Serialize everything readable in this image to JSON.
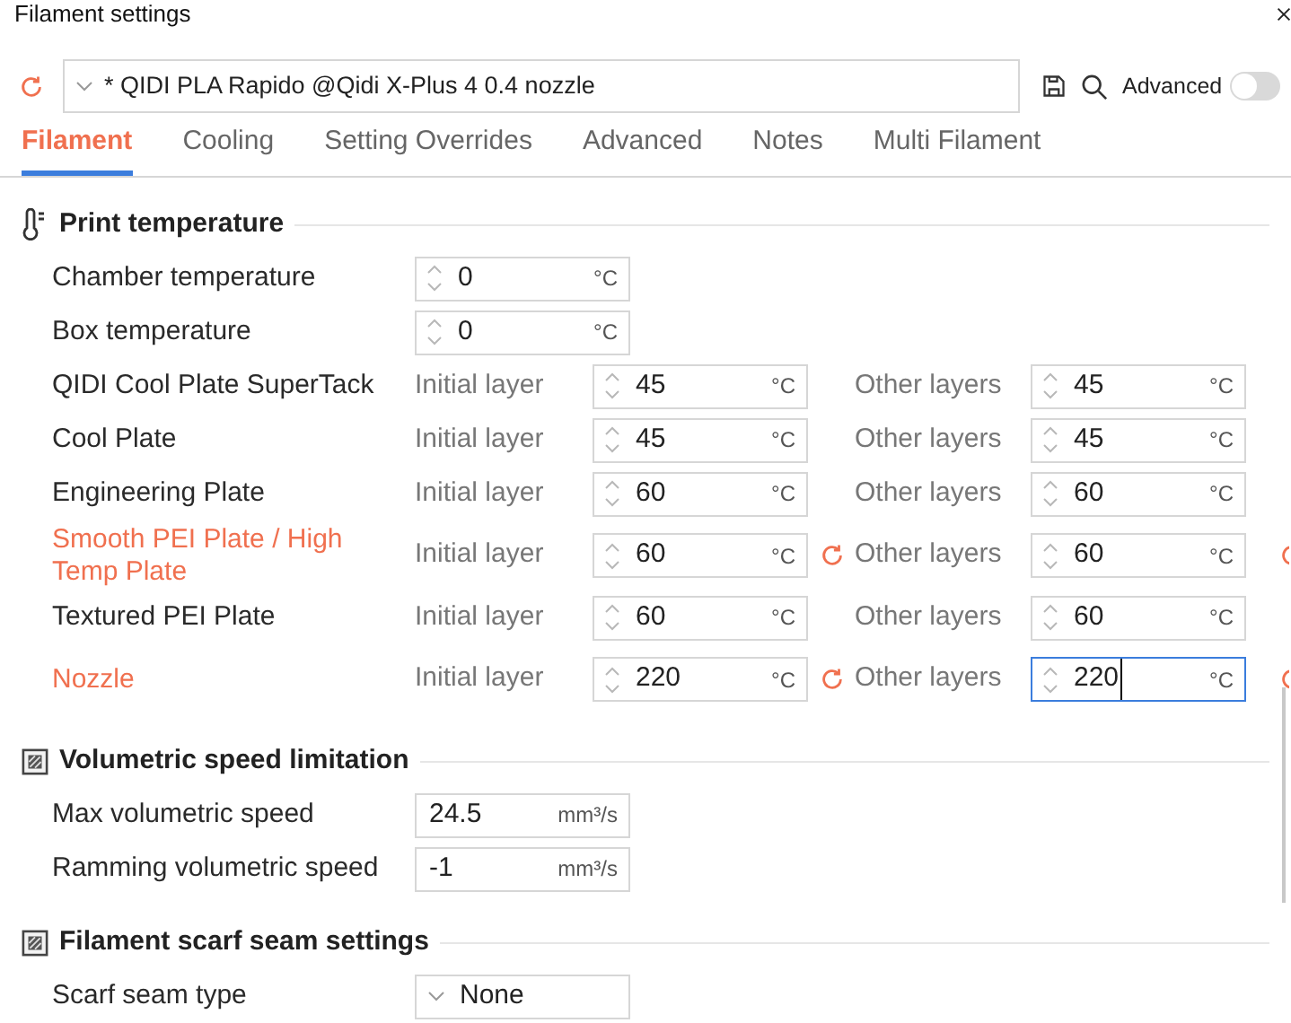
{
  "window": {
    "title": "Filament settings"
  },
  "preset": {
    "value": "* QIDI PLA Rapido @Qidi X-Plus 4 0.4 nozzle",
    "advanced_label": "Advanced",
    "advanced_on": false
  },
  "tabs": [
    {
      "label": "Filament",
      "selected": true
    },
    {
      "label": "Cooling",
      "selected": false
    },
    {
      "label": "Setting Overrides",
      "selected": false
    },
    {
      "label": "Advanced",
      "selected": false
    },
    {
      "label": "Notes",
      "selected": false
    },
    {
      "label": "Multi Filament",
      "selected": false
    }
  ],
  "sections": [
    {
      "title": "Print temperature",
      "rows": [
        {
          "kind": "single",
          "label": "Chamber temperature",
          "modified": false,
          "field": {
            "value": "0",
            "unit": "°C",
            "spinner": true,
            "focused": false
          }
        },
        {
          "kind": "single",
          "label": "Box temperature",
          "modified": false,
          "field": {
            "value": "0",
            "unit": "°C",
            "spinner": true,
            "focused": false
          }
        },
        {
          "kind": "pair",
          "label": "QIDI Cool Plate SuperTack",
          "modified": false,
          "initial_label": "Initial layer",
          "initial": {
            "value": "45",
            "unit": "°C",
            "spinner": true,
            "focused": false
          },
          "other_label": "Other layers",
          "other": {
            "value": "45",
            "unit": "°C",
            "spinner": true,
            "focused": false
          }
        },
        {
          "kind": "pair",
          "label": "Cool Plate",
          "modified": false,
          "initial_label": "Initial layer",
          "initial": {
            "value": "45",
            "unit": "°C",
            "spinner": true,
            "focused": false
          },
          "other_label": "Other layers",
          "other": {
            "value": "45",
            "unit": "°C",
            "spinner": true,
            "focused": false
          }
        },
        {
          "kind": "pair",
          "label": "Engineering Plate",
          "modified": false,
          "initial_label": "Initial layer",
          "initial": {
            "value": "60",
            "unit": "°C",
            "spinner": true,
            "focused": false
          },
          "other_label": "Other layers",
          "other": {
            "value": "60",
            "unit": "°C",
            "spinner": true,
            "focused": false
          }
        },
        {
          "kind": "pair",
          "label": "Smooth PEI Plate / High Temp Plate",
          "modified": true,
          "initial_label": "Initial layer",
          "initial": {
            "value": "60",
            "unit": "°C",
            "spinner": true,
            "focused": false
          },
          "other_label": "Other layers",
          "other": {
            "value": "60",
            "unit": "°C",
            "spinner": true,
            "focused": false
          }
        },
        {
          "kind": "pair",
          "label": "Textured PEI Plate",
          "modified": false,
          "initial_label": "Initial layer",
          "initial": {
            "value": "60",
            "unit": "°C",
            "spinner": true,
            "focused": false
          },
          "other_label": "Other layers",
          "other": {
            "value": "60",
            "unit": "°C",
            "spinner": true,
            "focused": false
          }
        },
        {
          "kind": "pair",
          "label": "Nozzle",
          "modified": true,
          "initial_label": "Initial layer",
          "initial": {
            "value": "220",
            "unit": "°C",
            "spinner": true,
            "focused": false
          },
          "other_label": "Other layers",
          "other": {
            "value": "220",
            "unit": "°C",
            "spinner": true,
            "focused": true
          }
        }
      ]
    },
    {
      "title": "Volumetric speed limitation",
      "rows": [
        {
          "kind": "single",
          "label": "Max volumetric speed",
          "modified": false,
          "field": {
            "value": "24.5",
            "unit": "mm³/s",
            "spinner": false,
            "focused": false
          }
        },
        {
          "kind": "single",
          "label": "Ramming volumetric speed",
          "modified": false,
          "field": {
            "value": "-1",
            "unit": "mm³/s",
            "spinner": false,
            "focused": false
          }
        }
      ]
    },
    {
      "title": "Filament scarf seam settings",
      "rows": [
        {
          "kind": "select",
          "label": "Scarf seam type",
          "modified": false,
          "value": "None"
        }
      ]
    }
  ]
}
